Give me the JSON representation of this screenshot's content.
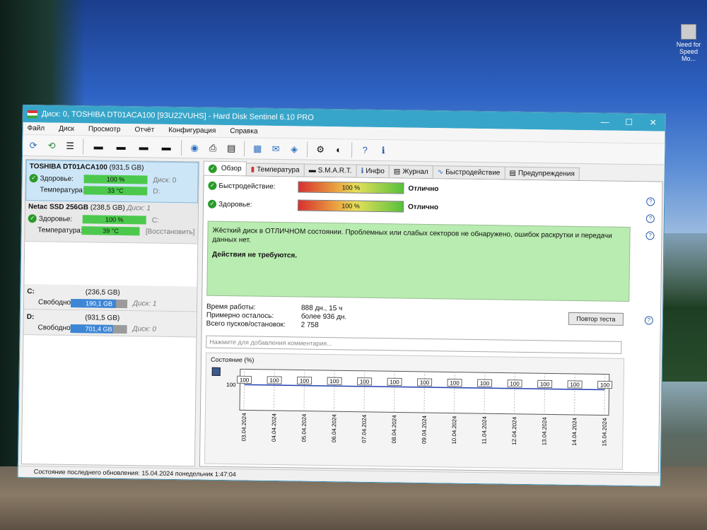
{
  "desktop": {
    "shortcut_label": "Need for Speed Mo..."
  },
  "window": {
    "title": "Диск: 0, TOSHIBA DT01ACA100 [93U22VUHS]  -  Hard Disk Sentinel 6.10 PRO",
    "controls": {
      "minimize": "—",
      "maximize": "☐",
      "close": "✕"
    }
  },
  "menu": [
    "Файл",
    "Диск",
    "Просмотр",
    "Отчёт",
    "Конфигурация",
    "Справка"
  ],
  "toolbar": {
    "icons": [
      "refresh-icon",
      "refresh-smart-icon",
      "disk-list-icon",
      "disk-temp-icon",
      "disk-info-icon",
      "disk-health-icon",
      "disk-test-icon",
      "network-icon",
      "print-icon",
      "report-icon",
      "report-text-icon",
      "mail-icon",
      "network-share-icon",
      "settings-icon",
      "sound-icon",
      "help-icon",
      "info-icon"
    ]
  },
  "disks": [
    {
      "name": "TOSHIBA DT01ACA100",
      "capacity": "(931,5 GB)",
      "health_label": "Здоровье:",
      "health": "100 %",
      "health_value": 100,
      "disk_no": "Диск: 0",
      "temp_label": "Температура:",
      "temp": "33 °C",
      "drive": "D:"
    },
    {
      "name": "Netac SSD 256GB",
      "capacity": "(238,5 GB)",
      "disk_no": "Диск: 1",
      "health_label": "Здоровье:",
      "health": "100 %",
      "health_value": 100,
      "drive": "C:",
      "temp_label": "Температура:",
      "temp": "39 °C",
      "restore": "[Восстановить]"
    }
  ],
  "partitions": [
    {
      "letter": "C:",
      "size": "(236,5 GB)",
      "free_label": "Свободно",
      "free": "190,1 GB",
      "free_fraction": 0.8,
      "disk": "Диск: 1"
    },
    {
      "letter": "D:",
      "size": "(931,5 GB)",
      "free_label": "Свободно",
      "free": "701,4 GB",
      "free_fraction": 0.75,
      "disk": "Диск: 0"
    }
  ],
  "tabs": [
    {
      "label": "Обзор",
      "icon": "check-icon"
    },
    {
      "label": "Температура",
      "icon": "thermometer-icon"
    },
    {
      "label": "S.M.A.R.T.",
      "icon": "smart-icon"
    },
    {
      "label": "Инфо",
      "icon": "info-icon"
    },
    {
      "label": "Журнал",
      "icon": "log-icon"
    },
    {
      "label": "Быстродействие",
      "icon": "performance-icon"
    },
    {
      "label": "Предупреждения",
      "icon": "warnings-icon"
    }
  ],
  "overview": {
    "performance_label": "Быстродействие:",
    "performance": "100 %",
    "performance_value": 100,
    "performance_status": "Отлично",
    "health_label": "Здоровье:",
    "health": "100 %",
    "health_value": 100,
    "health_status": "Отлично",
    "message": "Жёсткий диск в ОТЛИЧНОМ состоянии. Проблемных или слабых секторов не обнаружено, ошибок раскрутки и передачи данных нет.",
    "action": "Действия не требуются.",
    "uptime_label": "Время работы:",
    "uptime": "888 дн., 15 ч",
    "remaining_label": "Примерно осталось:",
    "remaining": "более 936 дн.",
    "starts_label": "Всего пусков/остановок:",
    "starts": "2 758",
    "retest_button": "Повтор теста",
    "comment_placeholder": "Нажмите для добавления комментария..."
  },
  "chart_data": {
    "type": "line",
    "title": "Состояние (%)",
    "x": [
      "03.04.2024",
      "04.04.2024",
      "05.04.2024",
      "06.04.2024",
      "07.04.2024",
      "08.04.2024",
      "09.04.2024",
      "10.04.2024",
      "11.04.2024",
      "12.04.2024",
      "13.04.2024",
      "14.04.2024",
      "15.04.2024"
    ],
    "series": [
      {
        "values": [
          100,
          100,
          100,
          100,
          100,
          100,
          100,
          100,
          100,
          100,
          100,
          100,
          100
        ]
      }
    ],
    "y_tick": "100",
    "ylim": [
      0,
      100
    ],
    "data_labels": true,
    "grid": true
  },
  "statusbar": "Состояние последнего обновления: 15.04.2024 понедельник 1:47:04"
}
